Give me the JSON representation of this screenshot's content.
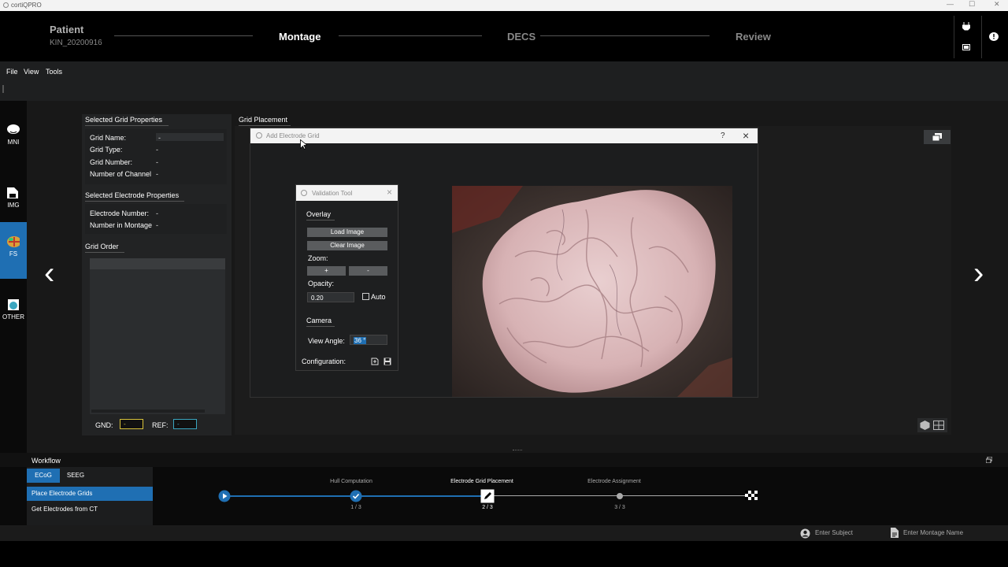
{
  "app": {
    "title": "cortiQPRO"
  },
  "header": {
    "patient_label": "Patient",
    "patient_id": "KIN_20200916",
    "steps": [
      "Montage",
      "DECS",
      "Review"
    ]
  },
  "menu": [
    "File",
    "View",
    "Tools"
  ],
  "leftnav": [
    {
      "label": "MNI",
      "icon": "brain-icon"
    },
    {
      "label": "IMG",
      "icon": "file-image-icon"
    },
    {
      "label": "FS",
      "icon": "freesurfer-brain-icon",
      "active": true
    },
    {
      "label": "OTHER",
      "icon": "globe-document-icon"
    }
  ],
  "grid_props": {
    "title": "Selected Grid Properties",
    "rows": [
      {
        "label": "Grid Name:",
        "value": "-"
      },
      {
        "label": "Grid Type:",
        "value": "-"
      },
      {
        "label": "Grid Number:",
        "value": "-"
      },
      {
        "label": "Number of Channel",
        "value": "-"
      }
    ]
  },
  "electrode_props": {
    "title": "Selected Electrode Properties",
    "rows": [
      {
        "label": "Electrode Number:",
        "value": "-"
      },
      {
        "label": "Number in Montage",
        "value": "-"
      }
    ]
  },
  "grid_order": {
    "title": "Grid Order",
    "gnd_label": "GND:",
    "gnd_value": "-",
    "ref_label": "REF:",
    "ref_value": "-"
  },
  "placement": {
    "title": "Grid Placement"
  },
  "add_dialog": {
    "title": "Add Electrode Grid",
    "help": "?",
    "close": "×"
  },
  "validation": {
    "title": "Validation Tool",
    "close": "×",
    "overlay_title": "Overlay",
    "load_image": "Load Image",
    "clear_image": "Clear Image",
    "zoom_label": "Zoom:",
    "zoom_in": "+",
    "zoom_out": "-",
    "opacity_label": "Opacity:",
    "opacity_value": "0.20",
    "auto_label": "Auto",
    "camera_title": "Camera",
    "view_angle_label": "View Angle:",
    "view_angle_value": "36 °",
    "config_label": "Configuration:"
  },
  "workflow": {
    "title": "Workflow",
    "tabs": [
      "ECoG",
      "SEEG"
    ],
    "items": [
      "Place Electrode Grids",
      "Get Electrodes from CT"
    ],
    "stages": [
      {
        "name": "Hull Computation",
        "step": "1 / 3"
      },
      {
        "name": "Electrode Grid Placement",
        "step": "2 / 3"
      },
      {
        "name": "Electrode Assignment",
        "step": "3 / 3"
      }
    ]
  },
  "status": {
    "subject_placeholder": "Enter Subject",
    "montage_placeholder": "Enter Montage Name"
  },
  "colors": {
    "accent": "#1f6fb3",
    "gnd": "#d8c23a",
    "ref": "#3aa6c0"
  }
}
